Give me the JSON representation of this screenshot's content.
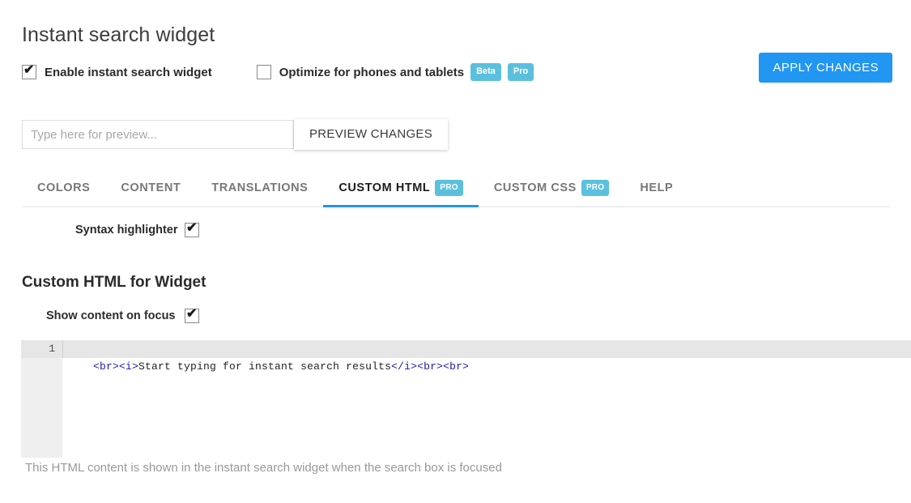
{
  "page": {
    "title": "Instant search widget",
    "section_heading": "Custom HTML for Widget",
    "help_text": "This HTML content is shown in the instant search widget when the search box is focused"
  },
  "toggles": [
    {
      "label": "Enable instant search widget",
      "checked": true,
      "badges": []
    },
    {
      "label": "Optimize for phones and tablets",
      "checked": false,
      "badges": [
        "Beta",
        "Pro"
      ]
    }
  ],
  "apply_button": {
    "label": "APPLY CHANGES",
    "color": "#2196f3"
  },
  "preview": {
    "placeholder": "Type here for preview...",
    "value": "",
    "button_label": "PREVIEW CHANGES"
  },
  "tabs": [
    {
      "label": "COLORS",
      "badge": "",
      "active": false
    },
    {
      "label": "CONTENT",
      "badge": "",
      "active": false
    },
    {
      "label": "TRANSLATIONS",
      "badge": "",
      "active": false
    },
    {
      "label": "CUSTOM HTML",
      "badge": "PRO",
      "active": true
    },
    {
      "label": "CUSTOM CSS",
      "badge": "PRO",
      "active": false
    },
    {
      "label": "HELP",
      "badge": "",
      "active": false
    }
  ],
  "settings": {
    "syntax_highlighter": {
      "label": "Syntax highlighter",
      "checked": true
    },
    "show_content_on_focus": {
      "label": "Show content on focus",
      "checked": true
    }
  },
  "editor": {
    "line_number": "1",
    "tokens": [
      {
        "text": "<br><i>",
        "type": "tag"
      },
      {
        "text": "Start typing for instant search results",
        "type": "text"
      },
      {
        "text": "</i><br><br>",
        "type": "tag"
      }
    ],
    "full_line": "<br><i>Start typing for instant search results</i><br><br>"
  },
  "colors": {
    "accent": "#2196f3",
    "badge": "#5bc0de",
    "tag": "#1a1ab3"
  }
}
